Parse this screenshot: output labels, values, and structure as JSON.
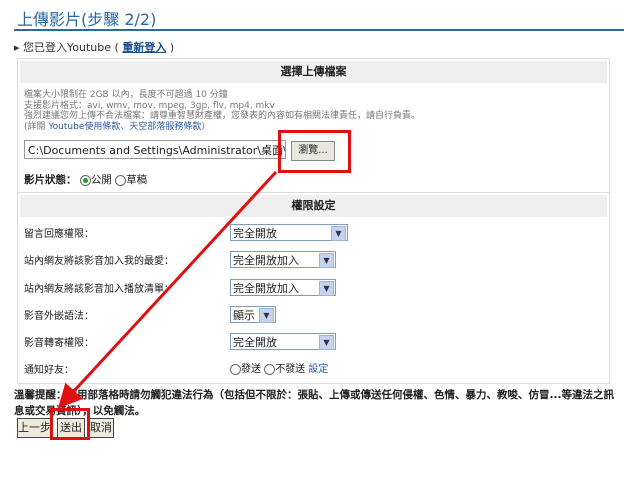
{
  "title": "上傳影片(步驟 2/2)",
  "login": {
    "text": "您已登入Youtube (",
    "link": "重新登入",
    "close": ")"
  },
  "upload": {
    "header": "選擇上傳檔案",
    "notes": [
      "檔案大小限制在 2GB 以內，長度不可超過 10 分鐘",
      "支援影片格式：avi, wmv, mov, mpeg, 3gp, flv, mp4, mkv",
      "強烈建議您勿上傳不合法檔案：請尊重智慧財產權，您發表的內容如有相關法律責任，請自行負責。"
    ],
    "terms_prefix": "(詳閱 ",
    "terms_link": "Youtube使用條款、天空部落服務條款",
    "terms_suffix": ")",
    "file_value": "C:\\Documents and Settings\\Administrator\\桌面\\Amazing",
    "browse": "瀏覽...",
    "status_label": "影片狀態：",
    "status_public": "公開",
    "status_draft": "草稿"
  },
  "perm": {
    "header": "權限設定",
    "rows": [
      {
        "label": "留言回應權限：",
        "value": "完全開放"
      },
      {
        "label": "站內網友將該影音加入我的最愛：",
        "value": "完全開放加入"
      },
      {
        "label": "站內網友將該影音加入播放清單：",
        "value": "完全開放加入"
      },
      {
        "label": "影音外嵌語法：",
        "value": "顯示"
      },
      {
        "label": "影音轉寄權限：",
        "value": "完全開放"
      }
    ],
    "notify_label": "通知好友：",
    "notify_send": "發送",
    "notify_nosend": "不發送",
    "notify_setting": "設定"
  },
  "warning": "溫馨提醒：使用部落格時請勿觸犯違法行為（包括但不限於：張貼、上傳或傳送任何侵權、色情、暴力、教唆、仿冒...等違法之訊息或交易資訊），以免觸法。",
  "buttons": {
    "prev": "上一步",
    "submit": "送出",
    "cancel": "取消"
  },
  "colors": {
    "accent": "#2a6aa6",
    "highlight": "#e01010"
  }
}
